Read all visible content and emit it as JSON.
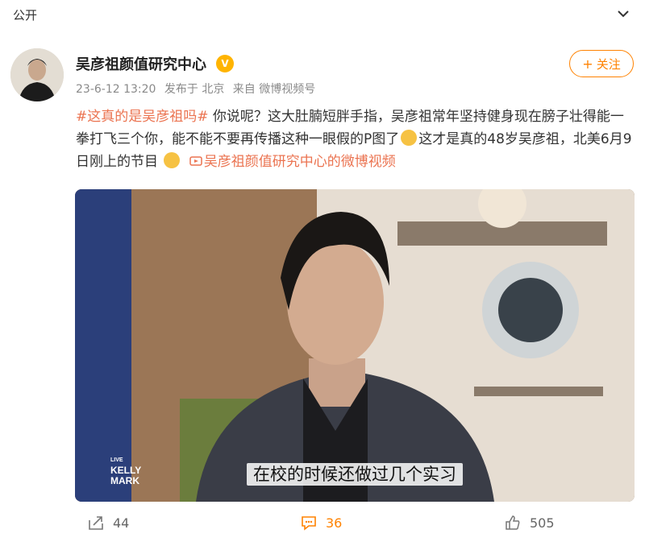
{
  "header": {
    "visibility": "公开"
  },
  "author": {
    "name": "吴彦祖颜值研究中心",
    "date": "23-6-12 13:20",
    "published_from": "发布于 北京",
    "source": "来自 微博视频号",
    "follow_label": "关注"
  },
  "post": {
    "hashtag": "#这真的是吴彦祖吗#",
    "text_part1": " 你说呢？这大肚腩短胖手指，吴彦祖常年坚持健身现在膀子壮得能一拳打飞三个你，能不能不要再传播这种一眼假的P图了",
    "text_part2": "这才是真的48岁吴彦祖，北美6月9日刚上的节目",
    "video_link": "吴彦祖颜值研究中心的微博视频"
  },
  "video": {
    "subtitle": "在校的时候还做过几个实习",
    "logo_live": "LIVE",
    "logo_line1": "KELLY",
    "logo_line2": "MARK"
  },
  "actions": {
    "shares": "44",
    "comments": "36",
    "likes": "505"
  },
  "colors": {
    "accent": "#ff8200",
    "link": "#eb7350"
  }
}
